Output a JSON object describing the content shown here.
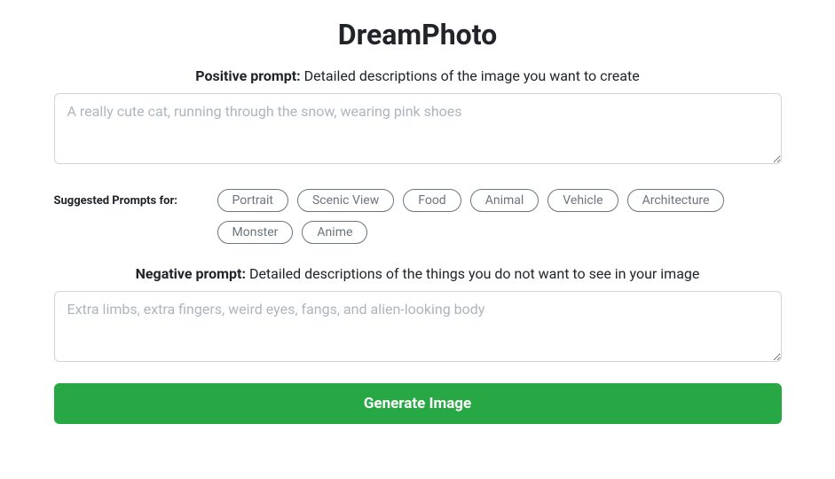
{
  "title": "DreamPhoto",
  "positive_prompt": {
    "label_bold": "Positive prompt:",
    "label_text": " Detailed descriptions of the image you want to create",
    "placeholder": "A really cute cat, running through the snow, wearing pink shoes",
    "value": ""
  },
  "suggested": {
    "label": "Suggested Prompts for:",
    "items": [
      "Portrait",
      "Scenic View",
      "Food",
      "Animal",
      "Vehicle",
      "Architecture",
      "Monster",
      "Anime"
    ]
  },
  "negative_prompt": {
    "label_bold": "Negative prompt:",
    "label_text": " Detailed descriptions of the things you do not want to see in your image",
    "placeholder": "Extra limbs, extra fingers, weird eyes, fangs, and alien-looking body",
    "value": ""
  },
  "generate_button": "Generate Image"
}
